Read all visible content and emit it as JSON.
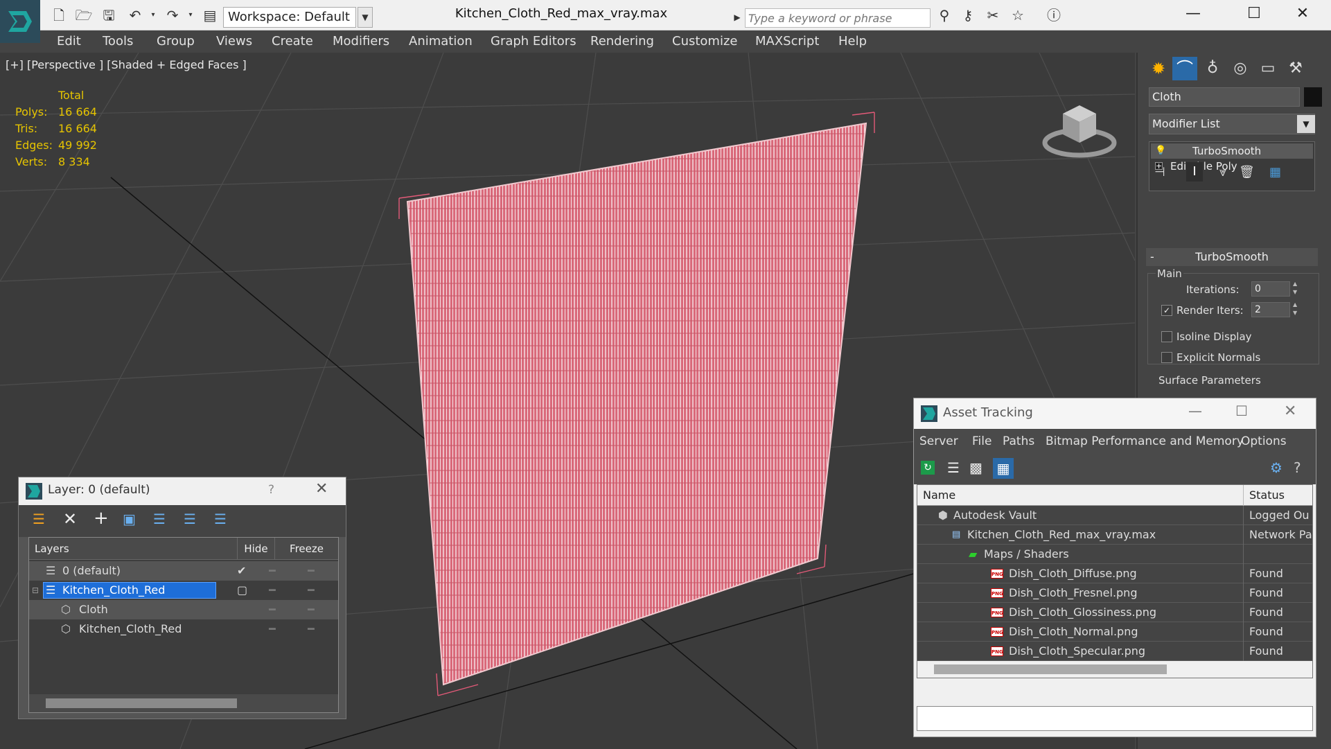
{
  "titlebar": {
    "workspace": "Workspace: Default",
    "file_title": "Kitchen_Cloth_Red_max_vray.max",
    "search_placeholder": "Type a keyword or phrase"
  },
  "menu": [
    "Edit",
    "Tools",
    "Group",
    "Views",
    "Create",
    "Modifiers",
    "Animation",
    "Graph Editors",
    "Rendering",
    "Customize",
    "MAXScript",
    "Help"
  ],
  "viewport": {
    "label": "[+] [Perspective ] [Shaded + Edged Faces ]",
    "stats_header": "Total",
    "stats": [
      {
        "label": "Polys:",
        "value": "16 664"
      },
      {
        "label": "Tris:",
        "value": "16 664"
      },
      {
        "label": "Edges:",
        "value": "49 992"
      },
      {
        "label": "Verts:",
        "value": "8 334"
      }
    ],
    "object_color": "#e87b86"
  },
  "command_panel": {
    "object_name": "Cloth",
    "modifier_list": "Modifier List",
    "stack": [
      "TurboSmooth",
      "Editable Poly"
    ],
    "rollout_title": "TurboSmooth",
    "group_main": "Main",
    "iterations_label": "Iterations:",
    "iterations_value": "0",
    "render_iters_label": "Render Iters:",
    "render_iters_value": "2",
    "render_iters_checked": true,
    "isoline_label": "Isoline Display",
    "explicit_normals_label": "Explicit Normals",
    "surface_params": "Surface Parameters"
  },
  "layer_dialog": {
    "title": "Layer: 0 (default)",
    "help": "?",
    "columns": {
      "layers": "Layers",
      "hide": "Hide",
      "freeze": "Freeze"
    },
    "rows": [
      {
        "name": "0 (default)"
      },
      {
        "name": "Kitchen_Cloth_Red"
      },
      {
        "name": "Cloth"
      },
      {
        "name": "Kitchen_Cloth_Red"
      }
    ]
  },
  "asset_tracking": {
    "title": "Asset Tracking",
    "menu": [
      "Server",
      "File",
      "Paths",
      "Bitmap Performance and Memory",
      "Options"
    ],
    "columns": {
      "name": "Name",
      "status": "Status"
    },
    "rows": [
      {
        "name": "Autodesk Vault",
        "status": "Logged Ou"
      },
      {
        "name": "Kitchen_Cloth_Red_max_vray.max",
        "status": "Network Pa"
      },
      {
        "name": "Maps / Shaders",
        "status": ""
      },
      {
        "name": "Dish_Cloth_Diffuse.png",
        "status": "Found"
      },
      {
        "name": "Dish_Cloth_Fresnel.png",
        "status": "Found"
      },
      {
        "name": "Dish_Cloth_Glossiness.png",
        "status": "Found"
      },
      {
        "name": "Dish_Cloth_Normal.png",
        "status": "Found"
      },
      {
        "name": "Dish_Cloth_Specular.png",
        "status": "Found"
      }
    ],
    "png_badge": "PNG"
  }
}
